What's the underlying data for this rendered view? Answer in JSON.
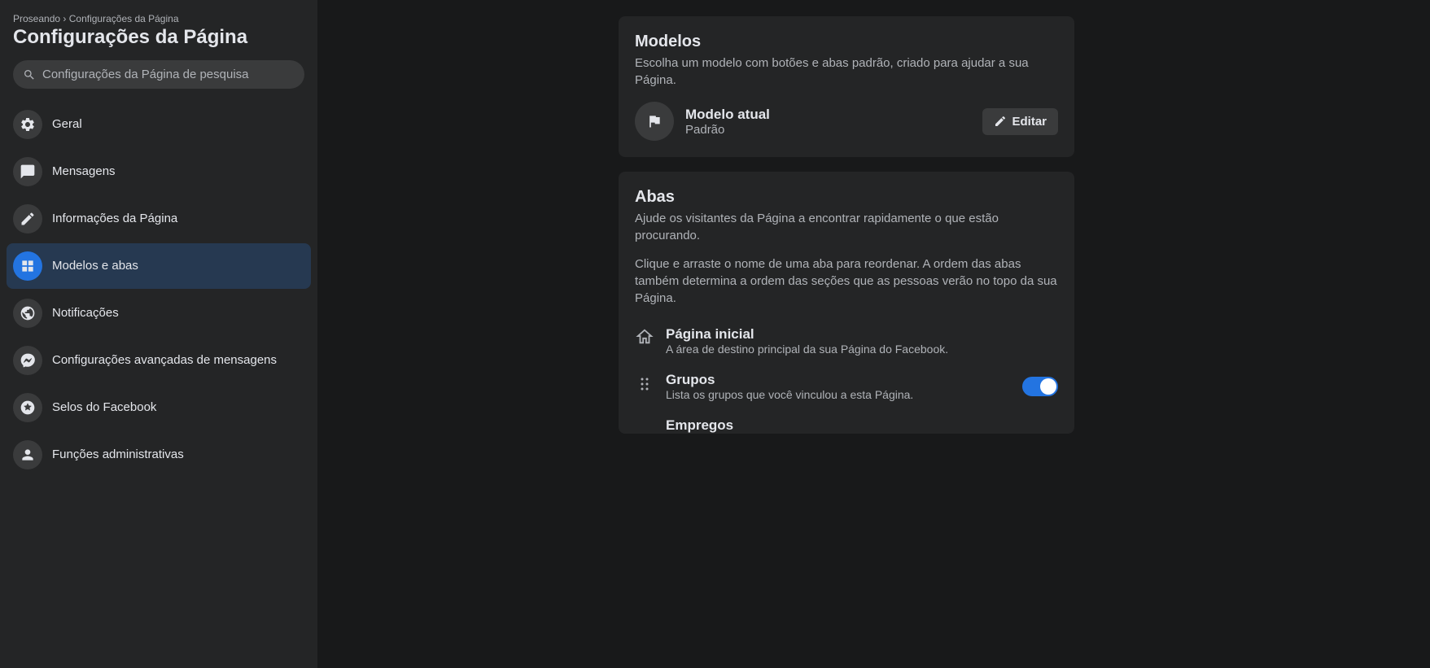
{
  "breadcrumb": {
    "parent": "Proseando",
    "separator": "›",
    "current": "Configurações da Página"
  },
  "page_title": "Configurações da Página",
  "search": {
    "placeholder": "Configurações da Página de pesquisa"
  },
  "sidebar": {
    "items": [
      {
        "label": "Geral",
        "icon": "gear-icon",
        "active": false
      },
      {
        "label": "Mensagens",
        "icon": "chat-icon",
        "active": false
      },
      {
        "label": "Informações da Página",
        "icon": "pencil-icon",
        "active": false
      },
      {
        "label": "Modelos e abas",
        "icon": "grid-icon",
        "active": true
      },
      {
        "label": "Notificações",
        "icon": "globe-icon",
        "active": false
      },
      {
        "label": "Configurações avançadas de mensagens",
        "icon": "messenger-icon",
        "active": false
      },
      {
        "label": "Selos do Facebook",
        "icon": "star-icon",
        "active": false
      },
      {
        "label": "Funções administrativas",
        "icon": "person-icon",
        "active": false
      }
    ]
  },
  "modelos_card": {
    "title": "Modelos",
    "description": "Escolha um modelo com botões e abas padrão, criado para ajudar a sua Página.",
    "current_label": "Modelo atual",
    "current_value": "Padrão",
    "edit_label": "Editar"
  },
  "abas_card": {
    "title": "Abas",
    "description1": "Ajude os visitantes da Página a encontrar rapidamente o que estão procurando.",
    "description2": "Clique e arraste o nome de uma aba para reordenar. A ordem das abas também determina a ordem das seções que as pessoas verão no topo da sua Página.",
    "home_tab": {
      "title": "Página inicial",
      "subtitle": "A área de destino principal da sua Página do Facebook."
    },
    "groups_tab": {
      "title": "Grupos",
      "subtitle": "Lista os grupos que você vinculou a esta Página.",
      "toggle": true
    },
    "partial_tab": {
      "title": "Empregos"
    }
  }
}
